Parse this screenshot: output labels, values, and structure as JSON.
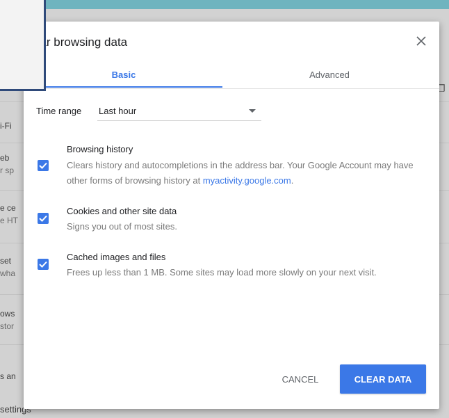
{
  "background": {
    "rows": [
      {
        "title": "i-Fi",
        "sub": ""
      },
      {
        "title": "eb",
        "sub": "r sp"
      },
      {
        "title": "e ce",
        "sub": "e HT"
      },
      {
        "title": "set",
        "sub": "wha"
      },
      {
        "title": "ows",
        "sub": "stor"
      },
      {
        "title": "s an",
        "sub": ""
      }
    ],
    "bottom_label": "settings"
  },
  "dialog": {
    "title": "ear browsing data",
    "tabs": [
      {
        "label": "Basic"
      },
      {
        "label": "Advanced"
      }
    ],
    "time_range": {
      "label": "Time range",
      "value": "Last hour"
    },
    "options": [
      {
        "title": "Browsing history",
        "desc_prefix": "Clears history and autocompletions in the address bar. Your Google Account may have other forms of browsing history at ",
        "desc_link": "myactivity.google.com",
        "desc_suffix": "."
      },
      {
        "title": "Cookies and other site data",
        "desc_prefix": "Signs you out of most sites.",
        "desc_link": "",
        "desc_suffix": ""
      },
      {
        "title": "Cached images and files",
        "desc_prefix": "Frees up less than 1 MB. Some sites may load more slowly on your next visit.",
        "desc_link": "",
        "desc_suffix": ""
      }
    ],
    "cancel_label": "CANCEL",
    "clear_label": "CLEAR DATA"
  },
  "colors": {
    "accent": "#3b78e7",
    "backdrop": "#6fb4bf"
  }
}
